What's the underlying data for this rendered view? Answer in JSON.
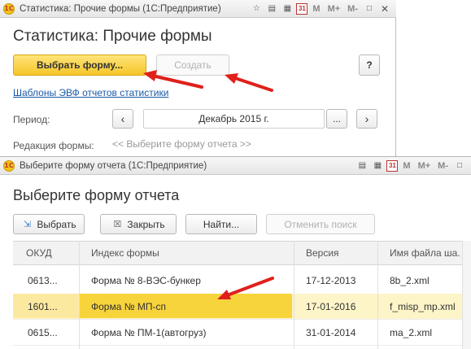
{
  "window1": {
    "title_bar": "Статистика: Прочие формы  (1С:Предприятие)",
    "heading": "Статистика: Прочие формы",
    "select_form_button": "Выбрать форму...",
    "create_button": "Создать",
    "help_button": "?",
    "templates_link": "Шаблоны ЭВФ отчетов статистики",
    "period_label": "Период:",
    "period_value": "Декабрь 2015 г.",
    "prev_button": "‹",
    "more_button": "...",
    "next_button": "›",
    "form_revision_label": "Редакция формы:",
    "form_revision_hint": "<< Выберите форму отчета >>"
  },
  "window2": {
    "title_bar": "Выберите форму отчета  (1С:Предприятие)",
    "heading": "Выберите форму отчета",
    "toolbar": {
      "select_label": "Выбрать",
      "close_label": "Закрыть",
      "find_label": "Найти...",
      "cancel_search_label": "Отменить поиск"
    },
    "table": {
      "columns": [
        "ОКУД",
        "Индекс формы",
        "Версия",
        "Имя файла ша..."
      ],
      "rows": [
        [
          "0613...",
          "Форма № 8-ВЭС-бункер",
          "17-12-2013",
          "8b_2.xml"
        ],
        [
          "1601...",
          "Форма № МП-сп",
          "17-01-2016",
          "f_misp_mp.xml"
        ],
        [
          "0615...",
          "Форма № ПМ-1(автогруз)",
          "31-01-2014",
          "ma_2.xml"
        ]
      ]
    }
  },
  "titlebar_icons": {
    "m": "M",
    "m_plus": "M+",
    "m_minus": "M-",
    "calendar": "31"
  },
  "colors": {
    "accent_yellow": "#f5c628",
    "selection_yellow": "#f8d43c",
    "link_blue": "#1a5aa8",
    "arrow_red": "#e0201b"
  }
}
